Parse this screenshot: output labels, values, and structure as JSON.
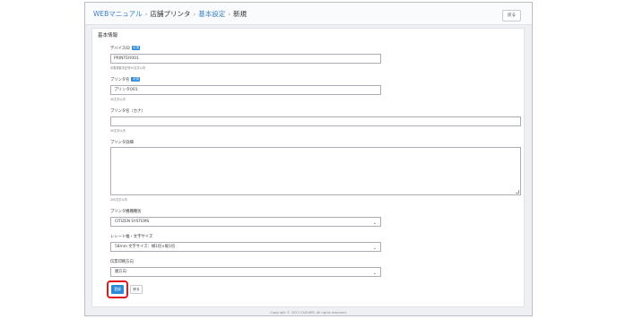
{
  "breadcrumb": {
    "items": [
      "WEBマニュアル",
      "店舗プリンタ",
      "基本設定",
      "新規"
    ]
  },
  "header": {
    "back_label": "戻る"
  },
  "section": {
    "title": "基本情報"
  },
  "fields": {
    "device_id": {
      "label": "デバイスID",
      "required": "必須",
      "value": "PRINTER001",
      "help": "半角英数字記号20文字以内"
    },
    "printer_name": {
      "label": "プリンタ名",
      "required": "必須",
      "value": "プリンタ001",
      "help": "40文字以内"
    },
    "printer_name_kana": {
      "label": "プリンタ名（カナ）",
      "value": "",
      "help": "40文字以内"
    },
    "description": {
      "label": "プリンタ詳細",
      "value": "",
      "help": "200文字以内"
    },
    "model_type": {
      "label": "プリンタ機種種別",
      "selected": "CITIZEN SYSTEMS"
    },
    "receipt_size": {
      "label": "レシート幅・文字サイズ",
      "selected": "58mm 文字サイズ：横1倍×縦1倍"
    },
    "print_direction": {
      "label": "伝票印刷方向",
      "selected": "順方向"
    }
  },
  "actions": {
    "save_label": "登録",
    "back_label": "戻る"
  },
  "footer": {
    "copyright": "Copyright © 2023 CASHIER. All rights reserved."
  },
  "colors": {
    "accent": "#2d8ad8",
    "highlight": "#e0191f"
  },
  "icons": {
    "separator": "chevron-right-icon",
    "select_caret": "chevron-down-icon"
  }
}
